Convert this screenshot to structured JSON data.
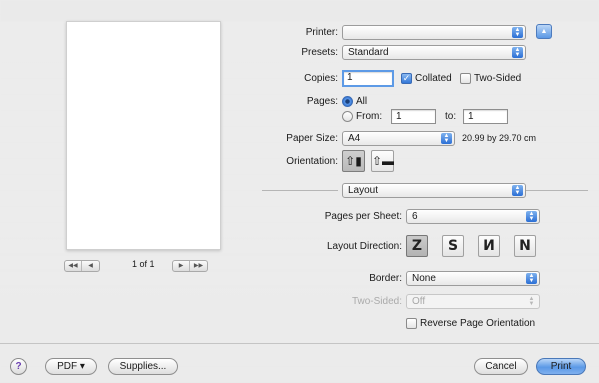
{
  "preview": {
    "page_indicator": "1 of 1",
    "nav": [
      "◀◀",
      "◀",
      "▶",
      "▶▶"
    ]
  },
  "printer": {
    "label": "Printer:",
    "value": ""
  },
  "presets": {
    "label": "Presets:",
    "value": "Standard"
  },
  "copies": {
    "label": "Copies:",
    "value": "1",
    "collated_label": "Collated",
    "collated_checked": true,
    "two_sided_label": "Two-Sided",
    "two_sided_checked": false
  },
  "pages": {
    "label": "Pages:",
    "all_label": "All",
    "from_label": "From:",
    "from_value": "1",
    "to_label": "to:",
    "to_value": "1",
    "selected": "All"
  },
  "paper_size": {
    "label": "Paper Size:",
    "value": "A4",
    "dimensions": "20.99 by 29.70 cm"
  },
  "orientation": {
    "label": "Orientation:",
    "selected": "portrait"
  },
  "section": {
    "value": "Layout"
  },
  "pages_per_sheet": {
    "label": "Pages per Sheet:",
    "value": "6"
  },
  "layout_direction": {
    "label": "Layout Direction:",
    "options": [
      "Z",
      "S",
      "И",
      "N"
    ],
    "selected_index": 0
  },
  "border": {
    "label": "Border:",
    "value": "None"
  },
  "two_sided": {
    "label": "Two-Sided:",
    "value": "Off",
    "enabled": false
  },
  "reverse": {
    "label": "Reverse Page Orientation",
    "checked": false
  },
  "footer": {
    "help": "?",
    "pdf": "PDF ▾",
    "supplies": "Supplies...",
    "cancel": "Cancel",
    "print": "Print"
  }
}
